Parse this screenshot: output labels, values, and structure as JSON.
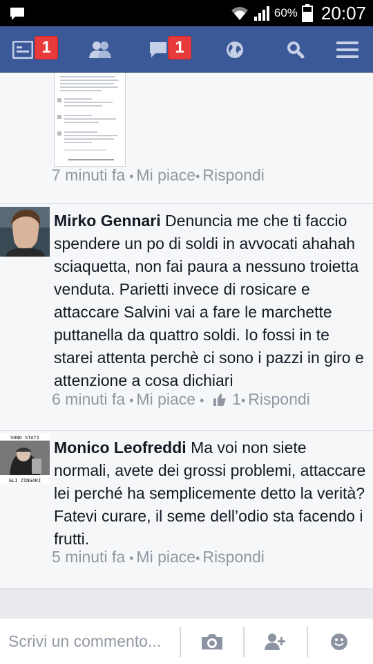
{
  "status_bar": {
    "battery_percent": "60%",
    "time": "20:07",
    "icons": [
      "notification-icon",
      "wifi-icon",
      "signal-icon",
      "battery-icon"
    ]
  },
  "nav": {
    "items": [
      {
        "name": "news-feed",
        "icon": "news-feed-icon",
        "badge": "1"
      },
      {
        "name": "friend-requests",
        "icon": "friends-icon",
        "badge": ""
      },
      {
        "name": "messages",
        "icon": "messages-icon",
        "badge": "1"
      },
      {
        "name": "notifications",
        "icon": "globe-icon",
        "badge": ""
      },
      {
        "name": "search",
        "icon": "search-icon",
        "badge": ""
      },
      {
        "name": "menu",
        "icon": "menu-icon",
        "badge": ""
      }
    ],
    "colors": {
      "bar": "#3b5998",
      "badge": "#e83a3a"
    }
  },
  "first_comment_meta": {
    "time": "7 minuti fa",
    "like": "Mi piace",
    "reply": "Rispondi"
  },
  "comments": [
    {
      "author": "Mirko Gennari",
      "text": "Denuncia me che ti faccio spendere un po di soldi in avvocati ahahah sciaquetta, non fai paura a nessuno troietta venduta. Parietti invece di rosicare e attaccare Salvini vai a fare le marchette puttanella da quattro soldi. Io fossi in te starei attenta perchè ci sono i pazzi in giro e attenzione a cosa dichiari",
      "time": "6 minuti fa",
      "like": "Mi piace",
      "like_count": "1",
      "reply": "Rispondi"
    },
    {
      "author": "Monico Leofreddi",
      "text": "Ma voi non siete normali, avete dei grossi problemi, attaccare lei perché ha semplicemente detto la verità? Fatevi curare, il seme dell’odio sta facendo i frutti.",
      "time": "5 minuti fa",
      "like": "Mi piace",
      "reply": "Rispondi",
      "avatar_caption": [
        "SONO STATI",
        "GLI ZINGARI"
      ]
    }
  ],
  "composer": {
    "placeholder": "Scrivi un commento...",
    "buttons": [
      "camera-icon",
      "add-friend-icon",
      "emoji-icon"
    ]
  }
}
